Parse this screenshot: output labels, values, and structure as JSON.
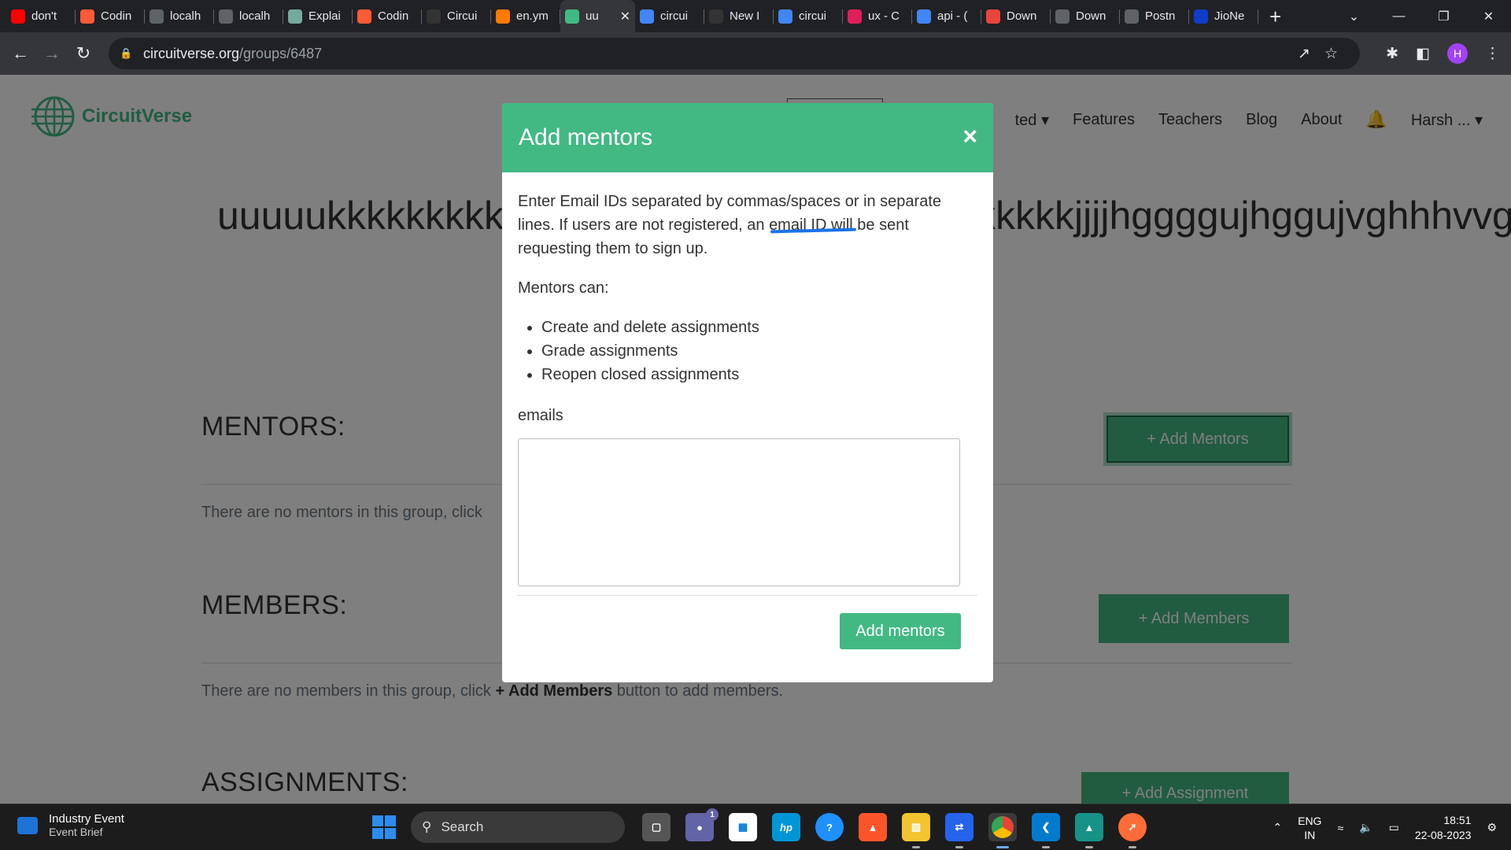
{
  "browser": {
    "tabs": [
      {
        "title": "don't",
        "icon": "youtube-icon",
        "color": "#ff0000"
      },
      {
        "title": "Codin",
        "icon": "coding-site-icon",
        "color": "#ff5a36"
      },
      {
        "title": "localh",
        "icon": "globe-icon",
        "color": "#5f6368"
      },
      {
        "title": "localh",
        "icon": "globe-icon",
        "color": "#5f6368"
      },
      {
        "title": "Explai",
        "icon": "chatgpt-icon",
        "color": "#74aa9c"
      },
      {
        "title": "Codin",
        "icon": "coding-site-icon",
        "color": "#ff5a36"
      },
      {
        "title": "Circui",
        "icon": "github-icon",
        "color": "#333333"
      },
      {
        "title": "en.ym",
        "icon": "g-icon",
        "color": "#ff7a00"
      },
      {
        "title": "uu",
        "icon": "circuitverse-icon",
        "color": "#42b983",
        "active": true
      },
      {
        "title": "circui",
        "icon": "google-icon",
        "color": "#4285f4"
      },
      {
        "title": "New I",
        "icon": "github-icon",
        "color": "#333333"
      },
      {
        "title": "circui",
        "icon": "google-icon",
        "color": "#4285f4"
      },
      {
        "title": "ux - C",
        "icon": "slack-icon",
        "color": "#e01e5a"
      },
      {
        "title": "api - (",
        "icon": "google-icon",
        "color": "#4285f4"
      },
      {
        "title": "Down",
        "icon": "download-site-icon",
        "color": "#e8453c"
      },
      {
        "title": "Down",
        "icon": "download-icon",
        "color": "#5f6368"
      },
      {
        "title": "Postn",
        "icon": "globe-icon",
        "color": "#5f6368"
      },
      {
        "title": "JioNe",
        "icon": "jio-icon",
        "color": "#0f3cc9"
      }
    ],
    "url_host": "circuitverse.org",
    "url_path": "/groups/6487",
    "profile_initial": "H"
  },
  "site": {
    "brand": "CircuitVerse",
    "nav": {
      "started_partial": "ted",
      "features": "Features",
      "teachers": "Teachers",
      "blog": "Blog",
      "about": "About",
      "user": "Harsh ..."
    },
    "group_title": "uuuuukkkkkkkkkkkkkkkkkkkkkkkkkkkkkkkkkkkkkkjjjjhggggujhggujvghhhvvg",
    "mentors": {
      "heading": "MENTORS:",
      "button": "+ Add Mentors",
      "empty_text": "There are no mentors in this group, click"
    },
    "members": {
      "heading": "MEMBERS:",
      "button": "+ Add Members",
      "empty_prefix": "There are no members in this group, click ",
      "empty_bold": "+ Add Members",
      "empty_suffix": " button to add members."
    },
    "assignments": {
      "heading": "ASSIGNMENTS:",
      "button": "+ Add Assignment"
    }
  },
  "modal": {
    "title": "Add mentors",
    "close": "×",
    "intro_before": "Enter Email IDs separated by commas/spaces or in separate lines. If users are not registered, an ",
    "intro_highlight": "email ID will",
    "intro_after": " be sent requesting them to sign up.",
    "can_label": "Mentors can:",
    "abilities": [
      "Create and delete assignments",
      "Grade assignments",
      "Reopen closed assignments"
    ],
    "emails_label": "emails",
    "emails_value": "",
    "submit": "Add mentors"
  },
  "taskbar": {
    "widget_title": "Industry Event",
    "widget_sub": "Event Brief",
    "search": "Search",
    "teams_badge": "1",
    "lang_top": "ENG",
    "lang_bottom": "IN",
    "time": "18:51",
    "date": "22-08-2023"
  },
  "colors": {
    "accent": "#42b983",
    "link": "#1a73e8"
  }
}
